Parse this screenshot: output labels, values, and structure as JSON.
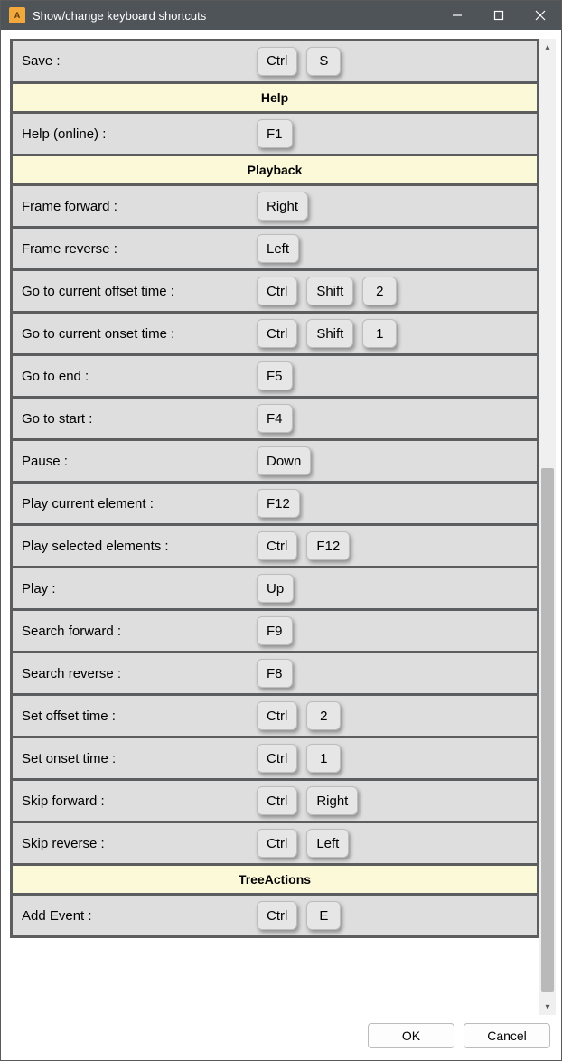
{
  "window": {
    "title": "Show/change keyboard shortcuts"
  },
  "sections": [
    {
      "header": null,
      "rows": [
        {
          "label": "Save :",
          "keys": [
            "Ctrl",
            "S"
          ]
        }
      ]
    },
    {
      "header": "Help",
      "rows": [
        {
          "label": "Help (online) :",
          "keys": [
            "F1"
          ]
        }
      ]
    },
    {
      "header": "Playback",
      "rows": [
        {
          "label": "Frame forward :",
          "keys": [
            "Right"
          ]
        },
        {
          "label": "Frame reverse :",
          "keys": [
            "Left"
          ]
        },
        {
          "label": "Go to current offset time :",
          "keys": [
            "Ctrl",
            "Shift",
            "2"
          ]
        },
        {
          "label": "Go to current onset time :",
          "keys": [
            "Ctrl",
            "Shift",
            "1"
          ]
        },
        {
          "label": "Go to end :",
          "keys": [
            "F5"
          ]
        },
        {
          "label": "Go to start :",
          "keys": [
            "F4"
          ]
        },
        {
          "label": "Pause :",
          "keys": [
            "Down"
          ]
        },
        {
          "label": "Play current element :",
          "keys": [
            "F12"
          ]
        },
        {
          "label": "Play selected elements :",
          "keys": [
            "Ctrl",
            "F12"
          ]
        },
        {
          "label": "Play :",
          "keys": [
            "Up"
          ]
        },
        {
          "label": "Search forward :",
          "keys": [
            "F9"
          ]
        },
        {
          "label": "Search reverse :",
          "keys": [
            "F8"
          ]
        },
        {
          "label": "Set offset time :",
          "keys": [
            "Ctrl",
            "2"
          ]
        },
        {
          "label": "Set onset time :",
          "keys": [
            "Ctrl",
            "1"
          ]
        },
        {
          "label": "Skip forward :",
          "keys": [
            "Ctrl",
            "Right"
          ]
        },
        {
          "label": "Skip reverse :",
          "keys": [
            "Ctrl",
            "Left"
          ]
        }
      ]
    },
    {
      "header": "TreeActions",
      "rows": [
        {
          "label": "Add Event :",
          "keys": [
            "Ctrl",
            "E"
          ]
        }
      ]
    }
  ],
  "footer": {
    "ok": "OK",
    "cancel": "Cancel"
  }
}
